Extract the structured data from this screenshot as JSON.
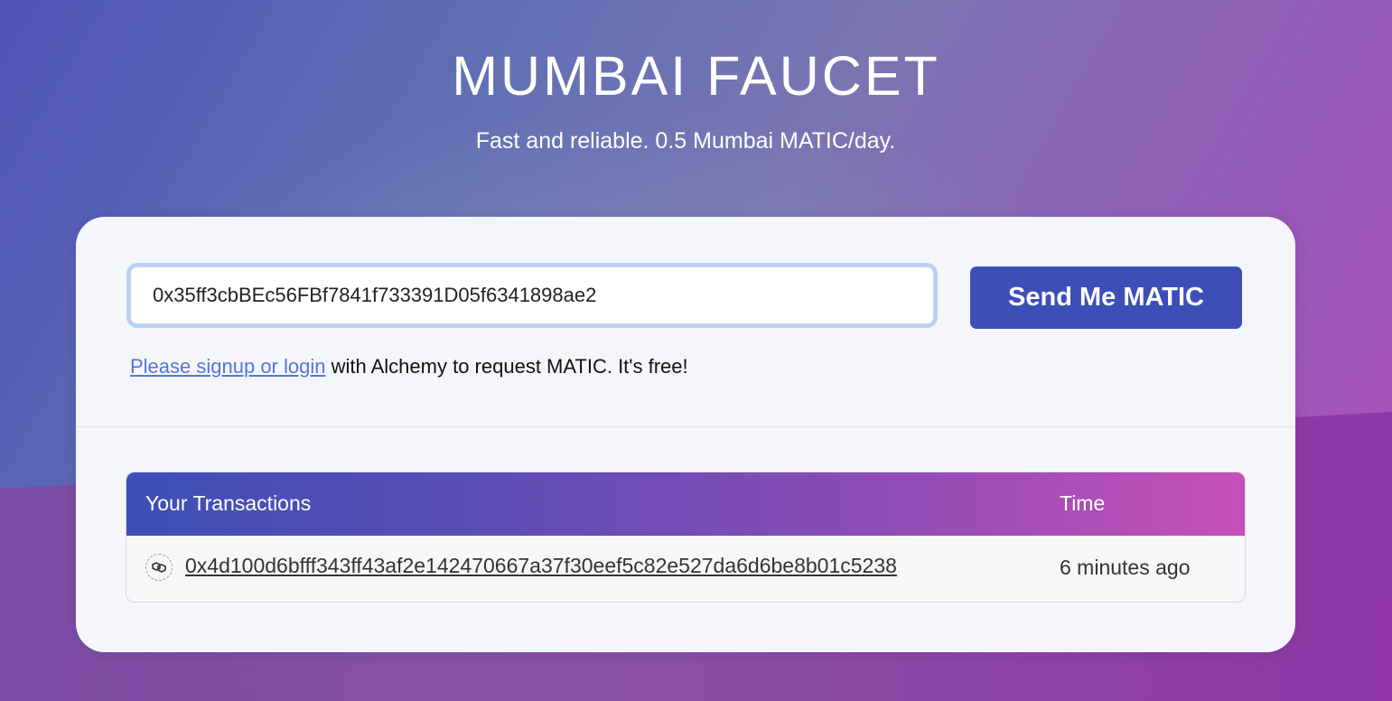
{
  "colors": {
    "accent": "#3d4eb8",
    "link": "#4f78d9",
    "card_background": "#f5f6fa"
  },
  "header": {
    "title": "MUMBAI FAUCET",
    "subtitle": "Fast and reliable. 0.5 Mumbai MATIC/day."
  },
  "form": {
    "address_value": "0x35ff3cbBEc56FBf7841f733391D05f6341898ae2",
    "send_label": "Send Me MATIC",
    "signup_link": "Please signup or login",
    "signup_text": " with Alchemy to request MATIC. It's free!"
  },
  "transactions": {
    "header_tx": "Your Transactions",
    "header_time": "Time",
    "rows": [
      {
        "icon": "polygon-icon",
        "hash": "0x4d100d6bfff343ff43af2e142470667a37f30eef5c82e527da6d6be8b01c5238",
        "time": "6 minutes ago"
      }
    ]
  }
}
